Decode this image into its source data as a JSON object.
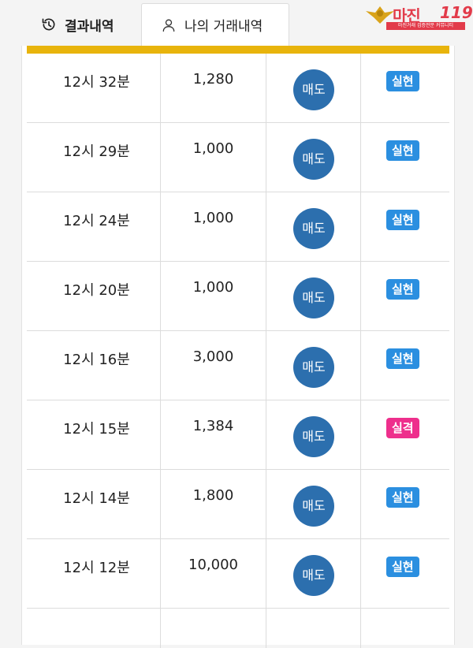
{
  "tabs": {
    "history_label": "결과내역",
    "my_trades_label": "나의 거래내역"
  },
  "logo": {
    "name": "마진",
    "number": "119",
    "tagline": "마진거래 검증전문 커뮤니티"
  },
  "colors": {
    "accent_bar": "#e8b40c",
    "sell_button": "#2c6fae",
    "status_realized": "#2b8fe0",
    "status_failed": "#ee2f8c"
  },
  "trades": [
    {
      "time": "12시 32분",
      "amount": "1,280",
      "action": "매도",
      "status": "실현",
      "status_type": "realized"
    },
    {
      "time": "12시 29분",
      "amount": "1,000",
      "action": "매도",
      "status": "실현",
      "status_type": "realized"
    },
    {
      "time": "12시 24분",
      "amount": "1,000",
      "action": "매도",
      "status": "실현",
      "status_type": "realized"
    },
    {
      "time": "12시 20분",
      "amount": "1,000",
      "action": "매도",
      "status": "실현",
      "status_type": "realized"
    },
    {
      "time": "12시 16분",
      "amount": "3,000",
      "action": "매도",
      "status": "실현",
      "status_type": "realized"
    },
    {
      "time": "12시 15분",
      "amount": "1,384",
      "action": "매도",
      "status": "실격",
      "status_type": "failed"
    },
    {
      "time": "12시 14분",
      "amount": "1,800",
      "action": "매도",
      "status": "실현",
      "status_type": "realized"
    },
    {
      "time": "12시 12분",
      "amount": "10,000",
      "action": "매도",
      "status": "실현",
      "status_type": "realized"
    }
  ]
}
